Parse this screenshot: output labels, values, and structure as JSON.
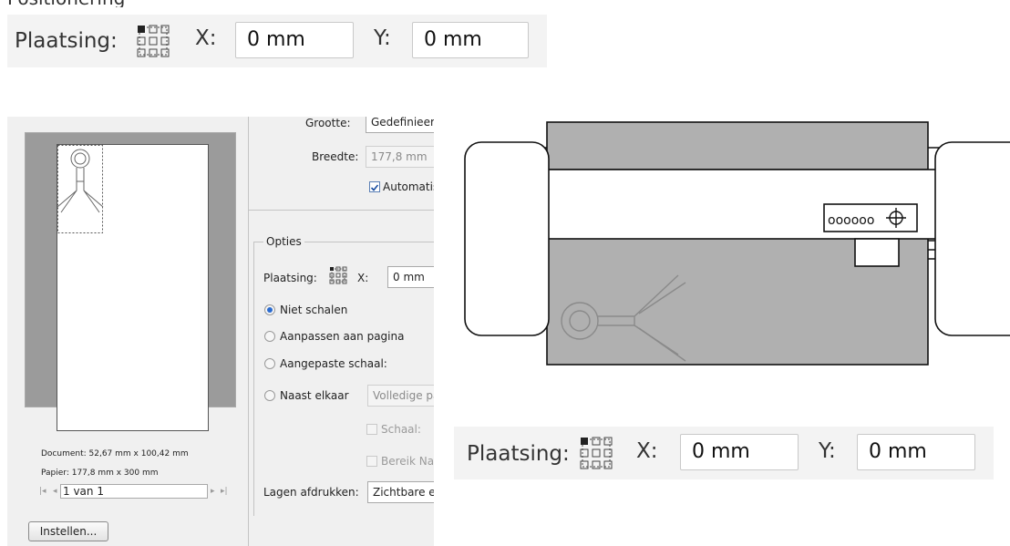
{
  "top_bar": {
    "heading_fragment": "Positionering",
    "label": "Plaatsing:",
    "x_label": "X:",
    "x_value": "0 mm",
    "y_label": "Y:",
    "y_value": "0 mm"
  },
  "dialog": {
    "size_label": "Grootte:",
    "size_value": "Gedefinieerd",
    "width_label": "Breedte:",
    "width_value": "177,8 mm",
    "auto_label": "Automatisch",
    "options_title": "Opties",
    "placement_label": "Plaatsing:",
    "x_label": "X:",
    "x_value": "0 mm",
    "radios": [
      {
        "label": "Niet schalen",
        "selected": true
      },
      {
        "label": "Aanpassen aan pagina",
        "selected": false
      },
      {
        "label": "Aangepaste schaal:",
        "selected": false
      },
      {
        "label": "Naast elkaar",
        "selected": false
      }
    ],
    "tile_value": "Volledige pagina",
    "scale_label": "Schaal:",
    "range_label": "Bereik Naast elkaar",
    "layers_label": "Lagen afdrukken:",
    "layers_value": "Zichtbare en",
    "document_info": "Document: 52,67 mm x 100,42 mm",
    "paper_info": "Papier: 177,8 mm x 300 mm",
    "page_value": "1 van 1",
    "setup_button": "Instellen..."
  },
  "bottom_bar": {
    "label": "Plaatsing:",
    "x_label": "X:",
    "x_value": "0 mm",
    "y_label": "Y:",
    "y_value": "0 mm"
  },
  "plotter": {
    "button_dots": "oooooo"
  }
}
